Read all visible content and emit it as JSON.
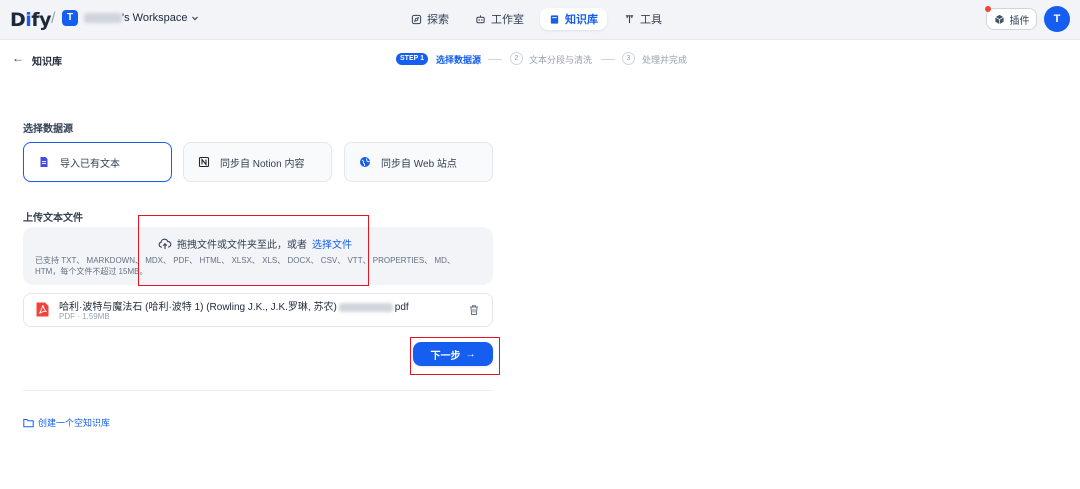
{
  "app": {
    "logo": "Dify",
    "workspace_initial": "T",
    "workspace_suffix": "'s Workspace",
    "workspace_chevron": "chevron-down-icon"
  },
  "nav": {
    "explore": "探索",
    "studio": "工作室",
    "knowledge": "知识库",
    "tools": "工具",
    "plugins": "插件",
    "user_initial": "T",
    "active": "knowledge"
  },
  "header": {
    "back_label": "知识库",
    "steps": [
      {
        "badge": "STEP 1",
        "label": "选择数据源",
        "state": "active"
      },
      {
        "num": "2",
        "label": "文本分段与清洗",
        "state": "inactive"
      },
      {
        "num": "3",
        "label": "处理并完成",
        "state": "inactive"
      }
    ]
  },
  "data_source": {
    "title": "选择数据源",
    "options": [
      {
        "label": "导入已有文本",
        "icon": "file-text-icon",
        "selected": true
      },
      {
        "label": "同步自 Notion 内容",
        "icon": "notion-icon",
        "selected": false
      },
      {
        "label": "同步自 Web 站点",
        "icon": "globe-icon",
        "selected": false
      }
    ]
  },
  "upload": {
    "title": "上传文本文件",
    "drop_text": "拖拽文件或文件夹至此，或者",
    "select_link": "选择文件",
    "hint": "已支持 TXT、 MARKDOWN、 MDX、 PDF、 HTML、 XLSX、 XLS、 DOCX、 CSV、 VTT、 PROPERTIES、 MD、 HTM，每个文件不超过 15MB。"
  },
  "file": {
    "name_prefix": "哈利·波特与魔法石 (哈利·波特 1) (Rowling J.K., J.K.罗琳, 苏农)",
    "name_suffix": "pdf",
    "meta": "PDF · 1.59MB"
  },
  "actions": {
    "next": "下一步",
    "create_empty": "创建一个空知识库"
  },
  "colors": {
    "accent": "#155eef",
    "highlight": "#e5141e",
    "pdf": "#f04438"
  }
}
